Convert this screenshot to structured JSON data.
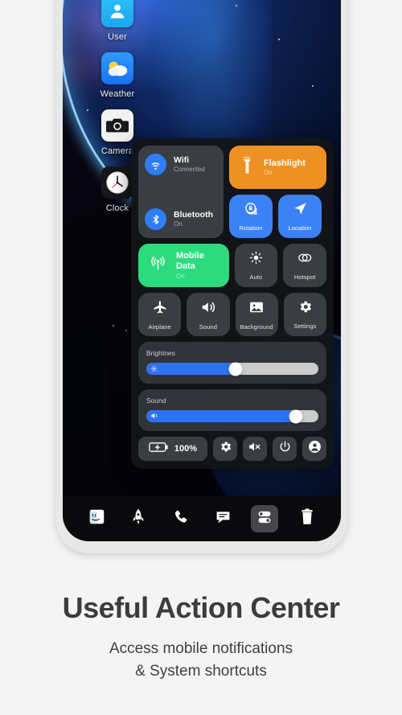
{
  "page": {
    "background_color": "#f4f4f4",
    "headline": "Useful Action Center",
    "subtitle_line1": "Access mobile notifications",
    "subtitle_line2": "& System shortcuts"
  },
  "desktop": {
    "apps": [
      {
        "label": "User",
        "icon": "user-icon"
      },
      {
        "label": "Weather",
        "icon": "weather-icon"
      },
      {
        "label": "Camera",
        "icon": "camera-icon"
      },
      {
        "label": "Clock",
        "icon": "clock-icon"
      }
    ]
  },
  "control_center": {
    "connectivity": {
      "wifi": {
        "title": "Wifi",
        "status": "Connected",
        "icon": "wifi-icon",
        "active": true
      },
      "bluetooth": {
        "title": "Bluetooth",
        "status": "On",
        "icon": "bluetooth-icon",
        "active": true
      }
    },
    "flashlight": {
      "title": "Flashlight",
      "status": "On",
      "icon": "flashlight-icon",
      "color": "#ef9023",
      "active": true
    },
    "mobile_data": {
      "title": "Mobile Data",
      "status": "On",
      "icon": "signal-icon",
      "color": "#2ddb7f",
      "active": true
    },
    "toggles": [
      {
        "label": "Rotation",
        "icon": "rotation-lock-icon",
        "active": true,
        "color": "#3b82f7"
      },
      {
        "label": "Location",
        "icon": "location-arrow-icon",
        "active": true,
        "color": "#3b82f7"
      },
      {
        "label": "Auto",
        "icon": "brightness-auto-icon",
        "active": false,
        "color": "#3a3d42"
      },
      {
        "label": "Hotspot",
        "icon": "hotspot-icon",
        "active": false,
        "color": "#3a3d42"
      },
      {
        "label": "Airplane",
        "icon": "airplane-icon",
        "active": false,
        "color": "#3a3d42"
      },
      {
        "label": "Sound",
        "icon": "speaker-icon",
        "active": false,
        "color": "#3a3d42"
      },
      {
        "label": "Background",
        "icon": "wallpaper-icon",
        "active": false,
        "color": "#3a3d42"
      },
      {
        "label": "Settings",
        "icon": "gear-icon",
        "active": false,
        "color": "#3a3d42"
      }
    ],
    "sliders": [
      {
        "label": "Brightnes",
        "value": 52,
        "icon": "brightness-icon"
      },
      {
        "label": "Sound",
        "value": 87,
        "icon": "volume-icon"
      }
    ],
    "actions": {
      "battery": {
        "label": "100%",
        "icon": "battery-charging-icon"
      },
      "buttons": [
        {
          "icon": "gear-icon",
          "name": "settings-button"
        },
        {
          "icon": "volume-mute-icon",
          "name": "mute-button"
        },
        {
          "icon": "power-icon",
          "name": "power-button"
        },
        {
          "icon": "account-icon",
          "name": "account-button"
        }
      ]
    }
  },
  "dock": {
    "items": [
      {
        "icon": "finder-icon",
        "name": "dock-finder",
        "active": false
      },
      {
        "icon": "launchpad-icon",
        "name": "dock-launchpad",
        "active": false
      },
      {
        "icon": "phone-icon",
        "name": "dock-phone",
        "active": false
      },
      {
        "icon": "messages-icon",
        "name": "dock-messages",
        "active": false
      },
      {
        "icon": "toggles-icon",
        "name": "dock-control-center",
        "active": true
      },
      {
        "icon": "trash-icon",
        "name": "dock-trash",
        "active": false
      }
    ]
  },
  "colors": {
    "accent_blue": "#3b82f7",
    "accent_orange": "#ef9023",
    "accent_green": "#2ddb7f",
    "tile_off": "#3a3d42",
    "panel_bg": "#121418"
  }
}
